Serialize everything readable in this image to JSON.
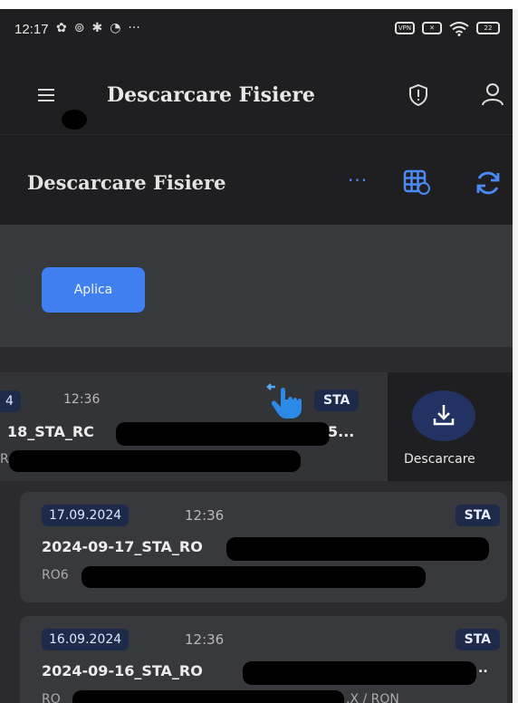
{
  "status_bar": {
    "time": "12:17",
    "notification_icons": [
      "settings-icon",
      "cloud-icon",
      "gear-icon",
      "chat-icon"
    ],
    "more": "···",
    "right_icons": [
      "vpn-icon",
      "x-icon",
      "wifi-icon",
      "battery-icon"
    ],
    "vpn_label": "VPN",
    "battery_label": "22"
  },
  "app_bar": {
    "title": "Descarcare Fisiere"
  },
  "subheader": {
    "title": "Descarcare Fisiere",
    "more_label": "···"
  },
  "filters": {
    "apply_label": "Aplica"
  },
  "files": [
    {
      "date": "4",
      "time": "12:36",
      "type": "STA",
      "name": "18_STA_RC",
      "name_tail": "5...",
      "sub": "R",
      "action_label": "Descarcare"
    },
    {
      "date": "17.09.2024",
      "time": "12:36",
      "type": "STA",
      "name": "2024-09-17_STA_RO",
      "sub": "RO6"
    },
    {
      "date": "16.09.2024",
      "time": "12:36",
      "type": "STA",
      "name": "2024-09-16_STA_RO",
      "name_tail": "..",
      "sub": "RO",
      "sub_tail": ".X / RON"
    }
  ],
  "colors": {
    "accent": "#3f7ff0",
    "badge_bg": "#1e2a4a",
    "background": "#2b2b2d",
    "header": "#1f1f21",
    "card": "#38393c"
  }
}
